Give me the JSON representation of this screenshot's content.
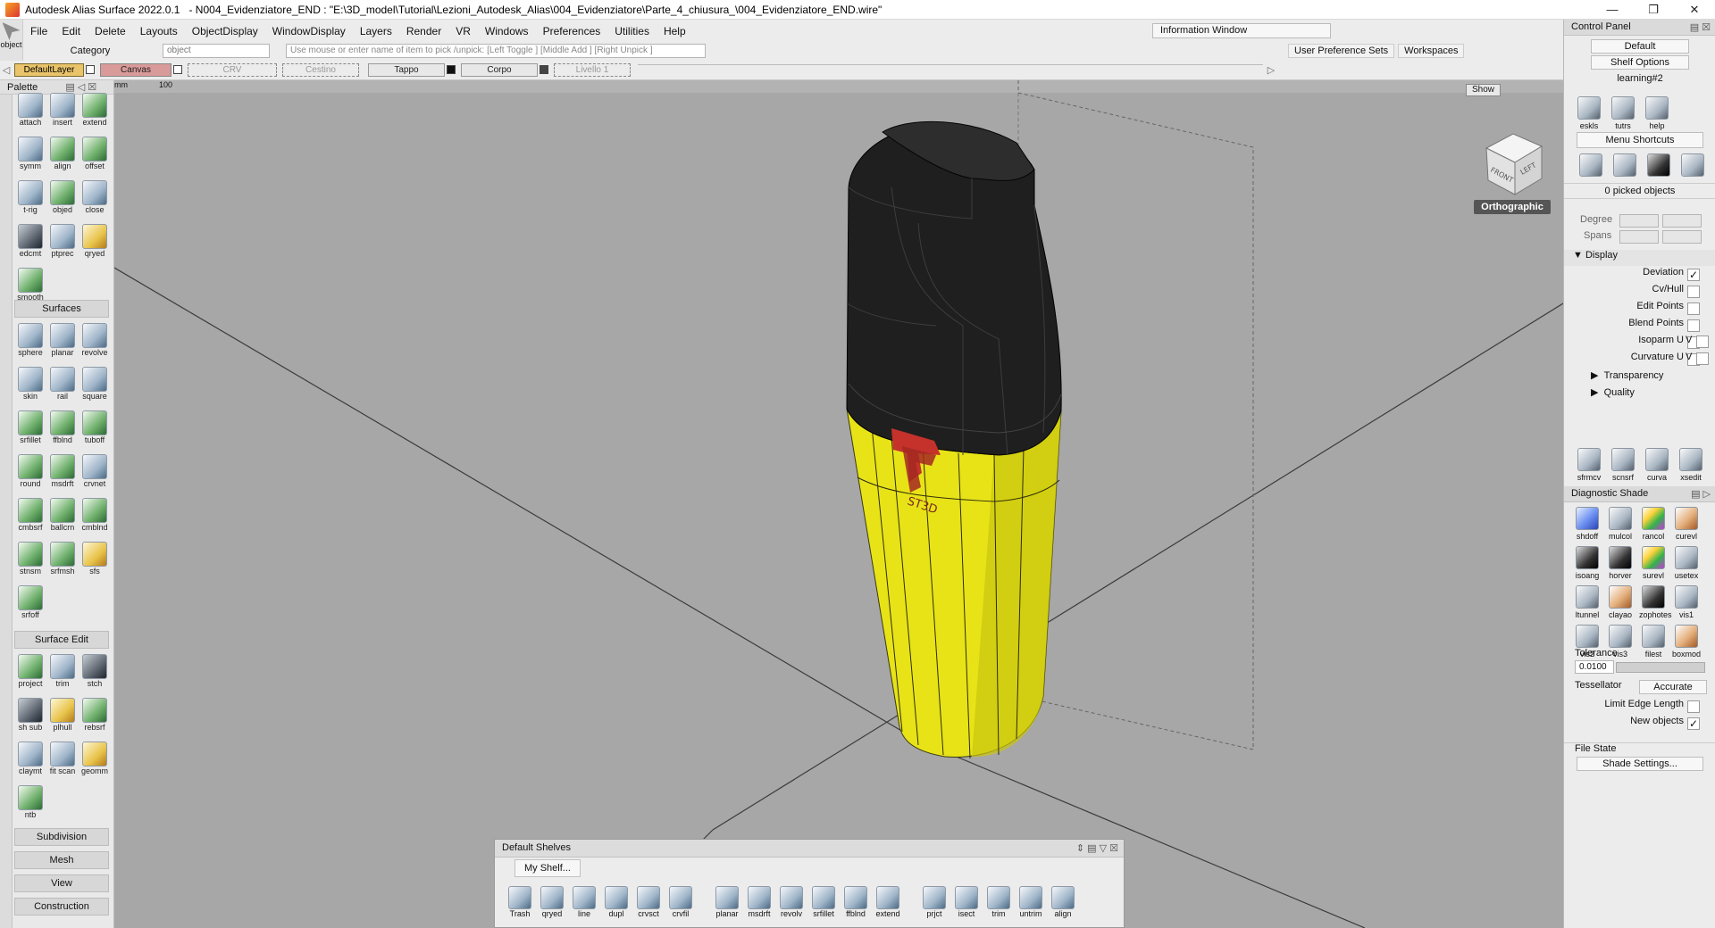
{
  "window": {
    "app_title": "Autodesk Alias Surface 2022.0.1",
    "file_title": "- N004_Evidenziatore_END : \"E:\\3D_model\\Tutorial\\Lezioni_Autodesk_Alias\\004_Evidenziatore\\Parte_4_chiusura_\\004_Evidenziatore_END.wire\"",
    "controls": [
      "—",
      "❐",
      "✕"
    ]
  },
  "menubar": {
    "items": [
      "File",
      "Edit",
      "Delete",
      "Layouts",
      "ObjectDisplay",
      "WindowDisplay",
      "Layers",
      "Render",
      "VR",
      "Windows",
      "Preferences",
      "Utilities",
      "Help"
    ],
    "pick_label": "object",
    "category_label": "Category",
    "category_value": "object",
    "prompt": "Use mouse or enter name of item to pick /unpick: [Left Toggle ] [Middle Add ] [Right Unpick ]",
    "info_window": "Information Window",
    "user_pref_sets": "User Preference Sets",
    "workspaces": "Workspaces"
  },
  "layers": {
    "items": [
      {
        "label": "DefaultLayer",
        "style": "active"
      },
      {
        "label": "Canvas",
        "style": "canvas"
      },
      {
        "label": "CRV",
        "style": "dashed"
      },
      {
        "label": "Cestino",
        "style": "dashed"
      },
      {
        "label": "Tappo",
        "style": "solid"
      },
      {
        "label": "Corpo",
        "style": "solid"
      },
      {
        "label": "Livello 1",
        "style": "dashed"
      }
    ]
  },
  "palette": {
    "title": "Palette",
    "units": "mm",
    "units_value": "100",
    "curve_tools": [
      {
        "label": "attach",
        "tone": "b"
      },
      {
        "label": "insert",
        "tone": "b"
      },
      {
        "label": "extend",
        "tone": "g"
      },
      {
        "label": "symm",
        "tone": "b"
      },
      {
        "label": "align",
        "tone": "g"
      },
      {
        "label": "offset",
        "tone": "g"
      },
      {
        "label": "t-rig",
        "tone": "b"
      },
      {
        "label": "objed",
        "tone": "g"
      },
      {
        "label": "close",
        "tone": "b"
      },
      {
        "label": "edcmt",
        "tone": "d"
      },
      {
        "label": "ptprec",
        "tone": "b"
      },
      {
        "label": "qryed",
        "tone": "y"
      },
      {
        "label": "smooth",
        "tone": "g"
      }
    ],
    "surfaces_header": "Surfaces",
    "surface_tools": [
      {
        "label": "sphere",
        "tone": "b"
      },
      {
        "label": "planar",
        "tone": "b"
      },
      {
        "label": "revolve",
        "tone": "b"
      },
      {
        "label": "skin",
        "tone": "b"
      },
      {
        "label": "rail",
        "tone": "b"
      },
      {
        "label": "square",
        "tone": "b"
      },
      {
        "label": "srfillet",
        "tone": "g"
      },
      {
        "label": "ffblnd",
        "tone": "g"
      },
      {
        "label": "tuboff",
        "tone": "g"
      },
      {
        "label": "round",
        "tone": "g"
      },
      {
        "label": "msdrft",
        "tone": "g"
      },
      {
        "label": "crvnet",
        "tone": "b"
      },
      {
        "label": "cmbsrf",
        "tone": "g"
      },
      {
        "label": "ballcrn",
        "tone": "g"
      },
      {
        "label": "cmblnd",
        "tone": "g"
      },
      {
        "label": "stnsm",
        "tone": "g"
      },
      {
        "label": "srfmsh",
        "tone": "g"
      },
      {
        "label": "sfs",
        "tone": "y"
      },
      {
        "label": "srfoff",
        "tone": "g"
      }
    ],
    "surface_edit_header": "Surface Edit",
    "surface_edit_tools": [
      {
        "label": "project",
        "tone": "g"
      },
      {
        "label": "trim",
        "tone": "b"
      },
      {
        "label": "stch",
        "tone": "d"
      },
      {
        "label": "sh sub",
        "tone": "d"
      },
      {
        "label": "plhull",
        "tone": "y"
      },
      {
        "label": "rebsrf",
        "tone": "g"
      },
      {
        "label": "claymt",
        "tone": "b"
      },
      {
        "label": "fit scan",
        "tone": "b"
      },
      {
        "label": "geomm",
        "tone": "y"
      },
      {
        "label": "ntb",
        "tone": "g"
      }
    ],
    "sections": [
      "Subdivision",
      "Mesh",
      "View",
      "Construction"
    ]
  },
  "viewport": {
    "view_label": "Orthographic",
    "cube_front": "FRONT",
    "cube_left": "LEFT",
    "show_label": "Show",
    "logo_text": "ST3D",
    "colors": {
      "background": "#a7a7a7",
      "body": "#e8e317",
      "cap": "#1f1f1f",
      "logo": "#c4322b"
    }
  },
  "shelves": {
    "title": "Default Shelves",
    "tab": "My Shelf...",
    "tools": [
      {
        "label": "Trash",
        "gap": false
      },
      {
        "label": "qryed",
        "gap": false
      },
      {
        "label": "line",
        "gap": false
      },
      {
        "label": "dupl",
        "gap": false
      },
      {
        "label": "crvsct",
        "gap": false
      },
      {
        "label": "crvfil",
        "gap": false
      },
      {
        "label": "planar",
        "gap": true
      },
      {
        "label": "msdrft",
        "gap": false
      },
      {
        "label": "revolv",
        "gap": false
      },
      {
        "label": "srfillet",
        "gap": false
      },
      {
        "label": "ffblnd",
        "gap": false
      },
      {
        "label": "extend",
        "gap": false
      },
      {
        "label": "prjct",
        "gap": true
      },
      {
        "label": "isect",
        "gap": false
      },
      {
        "label": "trim",
        "gap": false
      },
      {
        "label": "untrim",
        "gap": false
      },
      {
        "label": "align",
        "gap": false
      }
    ]
  },
  "control_panel": {
    "title": "Control Panel",
    "default": "Default",
    "shelf_options": "Shelf Options",
    "shelf_name": "learning#2",
    "learning_tools": [
      "eskls",
      "tutrs",
      "help"
    ],
    "menu_shortcuts": "Menu Shortcuts",
    "picked": "0 picked objects",
    "degree_label": "Degree",
    "spans_label": "Spans",
    "display_header": "Display",
    "display_rows": [
      {
        "label": "Deviation",
        "checked": true
      },
      {
        "label": "Cv/Hull",
        "checked": false
      },
      {
        "label": "Edit Points",
        "checked": false
      },
      {
        "label": "Blend Points",
        "checked": false
      },
      {
        "label": "Isoparm U",
        "checked": false
      },
      {
        "label": "Curvature U",
        "checked": false
      }
    ],
    "v_label": "V",
    "transparency": "Transparency",
    "quality": "Quality",
    "bottom_tools": [
      "sfrmcv",
      "scnsrf",
      "curva",
      "xsedit"
    ],
    "diag_header": "Diagnostic Shade",
    "diag_tools": [
      {
        "label": "shdoff",
        "tone": "p"
      },
      {
        "label": "mulcol",
        "tone": "b"
      },
      {
        "label": "rancol",
        "tone": "c"
      },
      {
        "label": "curevl",
        "tone": "r"
      },
      {
        "label": "isoang",
        "tone": "k"
      },
      {
        "label": "horver",
        "tone": "k"
      },
      {
        "label": "surevl",
        "tone": "c"
      },
      {
        "label": "usetex",
        "tone": "b"
      },
      {
        "label": "ltunnel",
        "tone": "b"
      },
      {
        "label": "clayao",
        "tone": "r"
      },
      {
        "label": "zophotes",
        "tone": "k"
      },
      {
        "label": "vis1",
        "tone": "b"
      },
      {
        "label": "vis2",
        "tone": "b"
      },
      {
        "label": "vis3",
        "tone": "b"
      },
      {
        "label": "filest",
        "tone": "b"
      },
      {
        "label": "boxmod",
        "tone": "r"
      }
    ],
    "tolerance_label": "Tolerance",
    "tolerance_value": "0.0100",
    "tessellator_label": "Tessellator",
    "tessellator_value": "Accurate",
    "limit_edge_length": "Limit Edge Length",
    "new_objects": "New objects",
    "new_objects_checked": true,
    "file_state": "File State",
    "shade_settings": "Shade Settings..."
  }
}
